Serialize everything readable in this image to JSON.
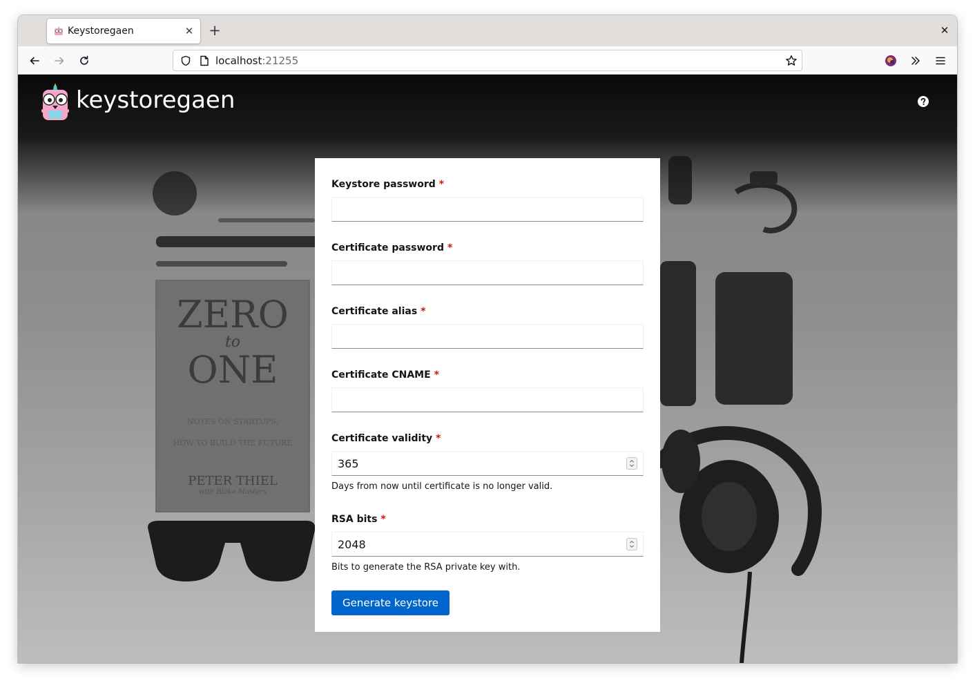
{
  "browser": {
    "tab": {
      "title": "Keystoregaen"
    },
    "address_bar": {
      "host": "localhost",
      "port": ":21255"
    }
  },
  "app": {
    "brand": "keystoregaen"
  },
  "form": {
    "keystore_password": {
      "label": "Keystore password",
      "required_mark": "*",
      "value": ""
    },
    "certificate_password": {
      "label": "Certificate password",
      "required_mark": "*",
      "value": ""
    },
    "certificate_alias": {
      "label": "Certificate alias",
      "required_mark": "*",
      "value": ""
    },
    "certificate_cname": {
      "label": "Certificate CNAME",
      "required_mark": "*",
      "value": ""
    },
    "certificate_validity": {
      "label": "Certificate validity",
      "required_mark": "*",
      "value": "365",
      "helper": "Days from now until certificate is no longer valid."
    },
    "rsa_bits": {
      "label": "RSA bits",
      "required_mark": "*",
      "value": "2048",
      "helper": "Bits to generate the RSA private key with."
    },
    "submit_label": "Generate keystore"
  },
  "background_photo": {
    "book_title": "ZERO",
    "book_to": "to",
    "book_one": "ONE",
    "book_subtitle_1": "NOTES ON STARTUPS,",
    "book_subtitle_2": "HOW TO BUILD THE FUTURE",
    "book_author": "PETER THIEL",
    "book_coauthor": "with Blake Masters"
  },
  "colors": {
    "primary": "#0066cc",
    "required": "#c9190b",
    "header_bg": "#151515"
  }
}
